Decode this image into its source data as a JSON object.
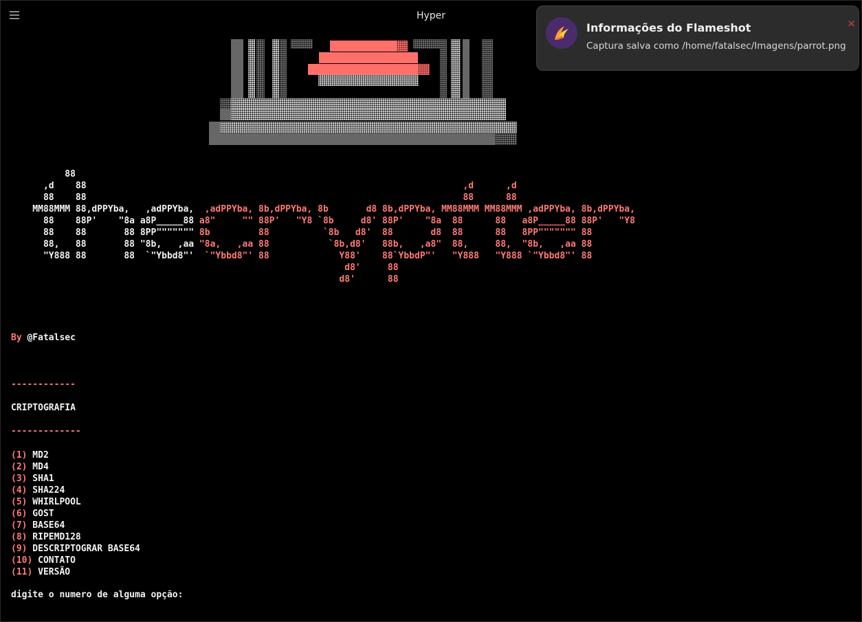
{
  "window": {
    "title": "Hyper"
  },
  "ascii_banner": {
    "lines": [
      [
        {
          "t": "          88",
          "c": "w"
        }
      ],
      [
        {
          "t": "      ,d    88",
          "c": "w"
        },
        {
          "t": "                                                                      ,d      ,d",
          "c": "r"
        }
      ],
      [
        {
          "t": "      88    88",
          "c": "w"
        },
        {
          "t": "                                                                      88      88",
          "c": "r"
        }
      ],
      [
        {
          "t": "    MM88MMM 88,dPPYba,   ,adPPYba, ",
          "c": "w"
        },
        {
          "t": " ,adPPYba, 8b,dPPYba, 8b       d8 8b,dPPYba, MM88MMM MM88MMM ,adPPYba, 8b,dPPYba,",
          "c": "r"
        }
      ],
      [
        {
          "t": "      88    88P'    \"8a a8P_____88",
          "c": "w"
        },
        {
          "t": " a8\"     \"\" 88P'   \"Y8 `8b     d8' 88P'    \"8a  88      88   a8P_____88 88P'   \"Y8",
          "c": "r"
        }
      ],
      [
        {
          "t": "      88    88       88 8PP\"\"\"\"\"\"\"",
          "c": "w"
        },
        {
          "t": " 8b         88          `8b   d8'  88       d8  88      88   8PP\"\"\"\"\"\"\" 88",
          "c": "r"
        }
      ],
      [
        {
          "t": "      88,   88       88 \"8b,   ,aa",
          "c": "w"
        },
        {
          "t": " \"8a,   ,aa 88           `8b,d8'   88b,   ,a8\"  88,     88,  \"8b,   ,aa 88",
          "c": "r"
        }
      ],
      [
        {
          "t": "      \"Y888 88       88  `\"Ybbd8\"'",
          "c": "w"
        },
        {
          "t": "  `\"Ybbd8\"' 88             Y88'    88`YbbdP\"'   \"Y888   \"Y888 `\"Ybbd8\"' 88",
          "c": "r"
        }
      ],
      [
        {
          "t": "                                                              d8'     88",
          "c": "r"
        }
      ],
      [
        {
          "t": "                                                             d8'      88",
          "c": "r"
        }
      ]
    ]
  },
  "byline": {
    "by": "By",
    "author": " @Fatalsec"
  },
  "separator_top": "------------",
  "section_title": "CRIPTOGRAFIA",
  "separator_bottom": "-------------",
  "menu": [
    {
      "num": "(1)",
      "label": " MD2"
    },
    {
      "num": "(2)",
      "label": " MD4"
    },
    {
      "num": "(3)",
      "label": " SHA1"
    },
    {
      "num": "(4)",
      "label": " SHA224"
    },
    {
      "num": "(5)",
      "label": " WHIRLPOOL"
    },
    {
      "num": "(6)",
      "label": " GOST"
    },
    {
      "num": "(7)",
      "label": " BASE64"
    },
    {
      "num": "(8)",
      "label": " RIPEMD128"
    },
    {
      "num": "(9)",
      "label": " DESCRIPTOGRAR BASE64"
    },
    {
      "num": "(10)",
      "label": " CONTATO"
    },
    {
      "num": "(11)",
      "label": " VERSÃO"
    }
  ],
  "prompt": "digite o numero de alguma opção:",
  "notification": {
    "title": "Informações do Flameshot",
    "body": "Captura salva como /home/fatalsec/Imagens/parrot.png",
    "close_glyph": "×",
    "icon": "flameshot-icon"
  },
  "colors": {
    "background": "#000000",
    "accent_red": "#ff7a76",
    "text": "#f2f2f2"
  }
}
